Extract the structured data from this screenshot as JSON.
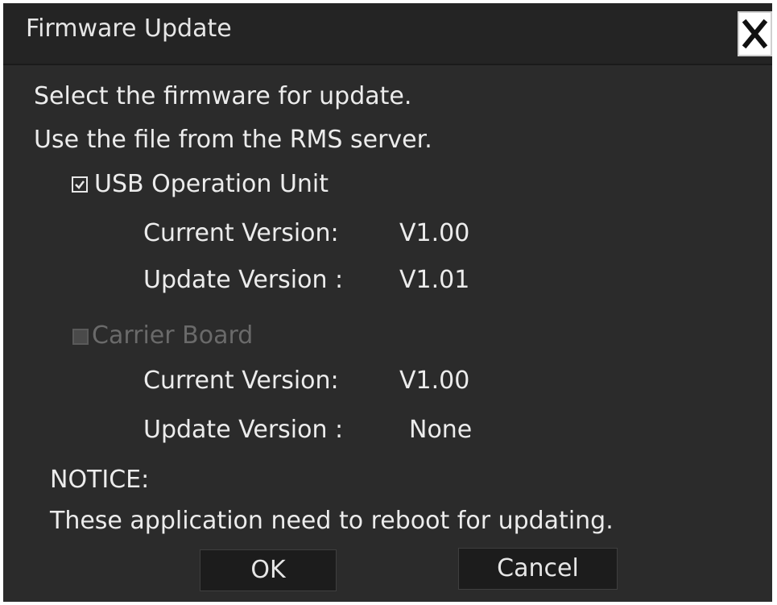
{
  "window": {
    "title": "Firmware Update"
  },
  "content": {
    "instruction_line1": "Select the firmware for update.",
    "instruction_line2": "Use the file from the RMS server."
  },
  "units": [
    {
      "label": "USB Operation Unit",
      "checked": true,
      "enabled": true,
      "current_label": "Current Version:",
      "current_value": "V1.00",
      "update_label": "Update Version :",
      "update_value": "V1.01"
    },
    {
      "label": "Carrier Board",
      "checked": false,
      "enabled": false,
      "current_label": "Current Version:",
      "current_value": "V1.00",
      "update_label": "Update Version :",
      "update_value": "None"
    }
  ],
  "notice": {
    "title": "NOTICE:",
    "text": "These application need to reboot for updating."
  },
  "buttons": {
    "ok": "OK",
    "cancel": "Cancel"
  },
  "icons": {
    "close": "close-icon",
    "checked": "checkmark-icon"
  },
  "colors": {
    "background": "#2b2b2b",
    "titlebar": "#242424",
    "button": "#1c1c1c",
    "text": "#ececec",
    "disabled_text": "#6a6a6a"
  }
}
